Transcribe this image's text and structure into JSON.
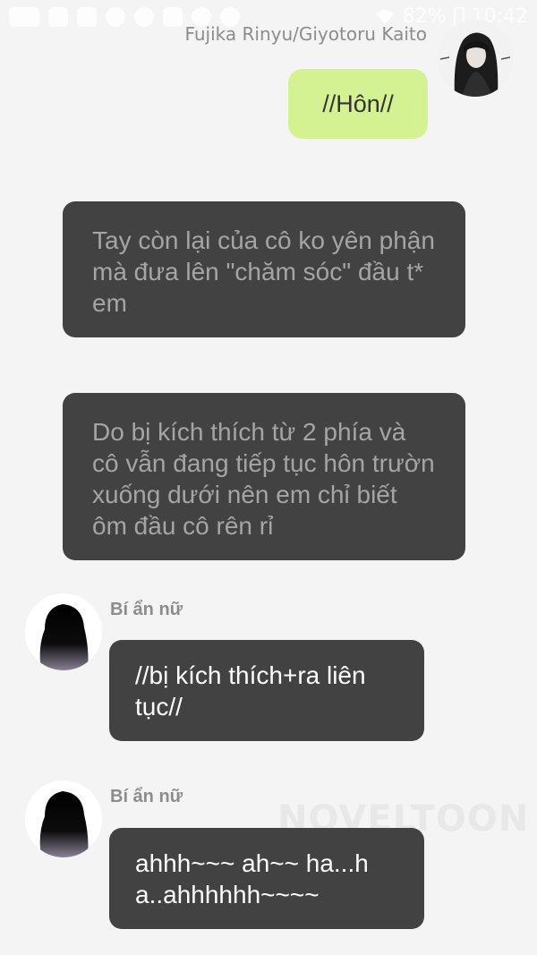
{
  "status_bar": {
    "battery": "82%",
    "time": "10:42"
  },
  "self": {
    "name": "Fujika Rinyu/Giyotoru Kaito",
    "message": "//Hôn//",
    "bubble_color": "#d4f291"
  },
  "narration": [
    {
      "text": "Tay còn lại của cô ko yên phận mà đưa lên \"chăm sóc\" đầu t* em"
    },
    {
      "text": "Do bị kích thích từ 2 phía và cô vẫn đang tiếp tục hôn trườn xuống dưới nên em chỉ biết ôm đầu cô rên rỉ"
    }
  ],
  "messages": [
    {
      "sender": "Bí ẩn nữ",
      "text": "//bị kích thích+ra liên tục//"
    },
    {
      "sender": "Bí ẩn nữ",
      "text": "ahhh~~~ ah~~ ha...h a..ahhhhhh~~~~"
    }
  ],
  "watermark": "NOVELTOON",
  "colors": {
    "background": "#f4f4f4",
    "dark_bubble": "#424242",
    "narration_text": "#a5a5a5",
    "message_text": "#ffffff",
    "name_text": "#8c8c8c"
  },
  "icons": [
    "notification-icons",
    "wifi-icon",
    "battery-icon",
    "avatar-anime-girl",
    "avatar-silhouette"
  ]
}
